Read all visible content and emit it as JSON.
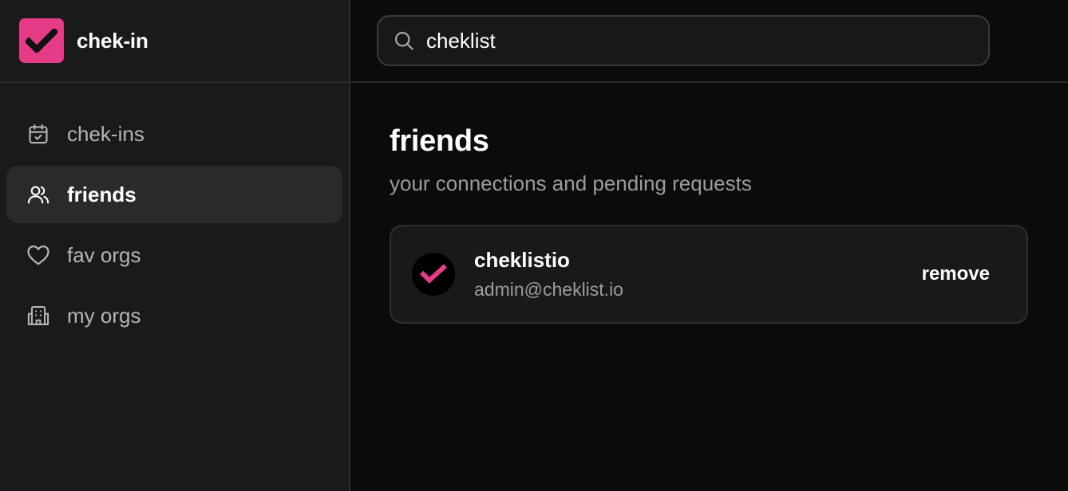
{
  "app": {
    "name": "chek-in",
    "brand_color": "#e63b86"
  },
  "sidebar": {
    "items": [
      {
        "label": "chek-ins",
        "icon": "calendar-check-icon",
        "active": false
      },
      {
        "label": "friends",
        "icon": "users-icon",
        "active": true
      },
      {
        "label": "fav orgs",
        "icon": "heart-icon",
        "active": false
      },
      {
        "label": "my orgs",
        "icon": "building-icon",
        "active": false
      }
    ]
  },
  "search": {
    "value": "cheklist",
    "icon": "search-icon"
  },
  "page": {
    "title": "friends",
    "subtitle": "your connections and pending requests"
  },
  "friends": [
    {
      "name": "cheklistio",
      "email": "admin@cheklist.io",
      "action_label": "remove"
    }
  ]
}
